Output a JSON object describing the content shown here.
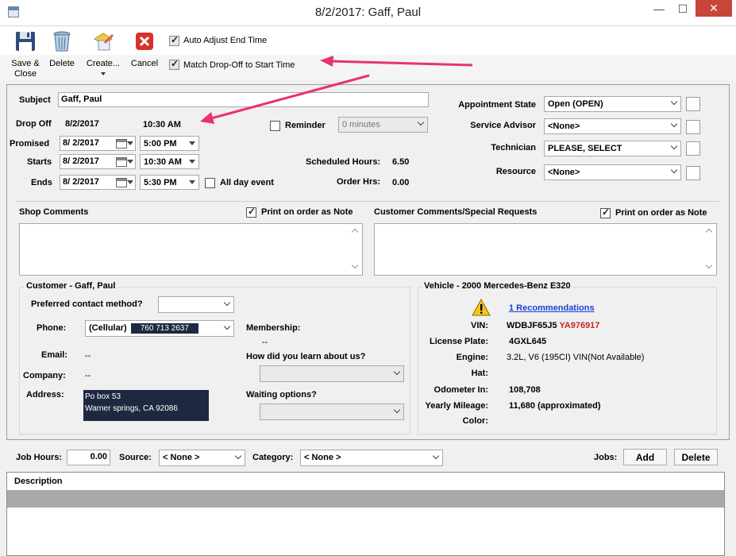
{
  "window": {
    "title": "8/2/2017: Gaff, Paul",
    "minimize": "—",
    "maximize": "☐",
    "close": "✕"
  },
  "toolbar": {
    "save_close": "Save &\nClose",
    "delete": "Delete",
    "create": "Create...",
    "cancel": "Cancel",
    "auto_adjust": "Auto Adjust End Time",
    "match_dropoff": "Match Drop-Off to Start Time"
  },
  "appointment": {
    "subject_label": "Subject",
    "subject_value": "Gaff, Paul",
    "dropoff_label": "Drop Off",
    "dropoff_date": "8/2/2017",
    "dropoff_time": "10:30 AM",
    "reminder_label": "Reminder",
    "reminder_value": "0 minutes",
    "promised_label": "Promised",
    "promised_date": "8/  2/2017",
    "promised_time": "5:00 PM",
    "starts_label": "Starts",
    "starts_date": "8/  2/2017",
    "starts_time": "10:30 AM",
    "ends_label": "Ends",
    "ends_date": "8/  2/2017",
    "ends_time": "5:30 PM",
    "all_day_label": "All day event",
    "scheduled_hours_label": "Scheduled Hours:",
    "scheduled_hours_value": "6.50",
    "order_hrs_label": "Order Hrs:",
    "order_hrs_value": "0.00"
  },
  "right_panel": {
    "state_label": "Appointment State",
    "state_value": "Open (OPEN)",
    "advisor_label": "Service Advisor",
    "advisor_value": "<None>",
    "technician_label": "Technician",
    "technician_value": "PLEASE, SELECT",
    "resource_label": "Resource",
    "resource_value": "<None>"
  },
  "comments": {
    "shop_label": "Shop Comments",
    "shop_print": "Print on order as Note",
    "customer_label": "Customer Comments/Special Requests",
    "customer_print": "Print on order as Note"
  },
  "customer": {
    "group_title": "Customer - Gaff, Paul",
    "contact_label": "Preferred contact method?",
    "phone_label": "Phone:",
    "phone_type": "(Cellular)",
    "phone_number": "760 713 2637",
    "email_label": "Email:",
    "email_value": "--",
    "company_label": "Company:",
    "company_value": "--",
    "address_label": "Address:",
    "address_line1": "Po box 53",
    "address_line2": "Warner springs, CA 92086",
    "membership_label": "Membership:",
    "membership_value": "--",
    "learn_label": "How did you learn about us?",
    "waiting_label": "Waiting options?"
  },
  "vehicle": {
    "group_title": "Vehicle - 2000 Mercedes-Benz E320",
    "recommendations": "1 Recommendations",
    "vin_label": "VIN:",
    "vin_part1": "WDBJF65J5",
    "vin_part2": "YA976917",
    "plate_label": "License Plate:",
    "plate_value": "4GXL645",
    "engine_label": "Engine:",
    "engine_value": "3.2L, V6 (195CI) VIN(Not Available)",
    "hat_label": "Hat:",
    "odometer_label": "Odometer In:",
    "odometer_value": "108,708",
    "mileage_label": "Yearly Mileage:",
    "mileage_value": "11,680 (approximated)",
    "color_label": "Color:"
  },
  "jobs_bar": {
    "job_hours_label": "Job Hours:",
    "job_hours_value": "0.00",
    "source_label": "Source:",
    "source_value": "< None >",
    "category_label": "Category:",
    "category_value": "< None >",
    "jobs_label": "Jobs:",
    "add": "Add",
    "delete": "Delete"
  },
  "grid": {
    "description_header": "Description"
  },
  "colors": {
    "annotation_arrow": "#e8336d",
    "link": "#1b3fd6",
    "vin_highlight": "#c62828",
    "close_button": "#c7463a"
  }
}
